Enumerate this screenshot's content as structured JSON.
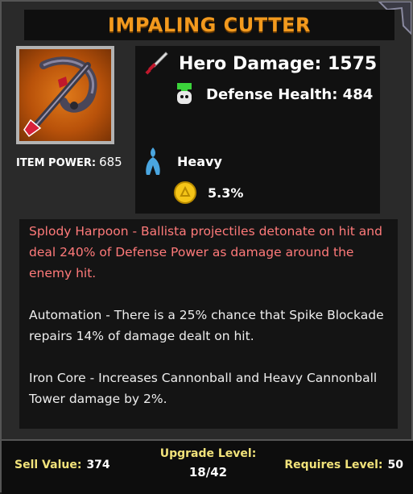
{
  "title": "IMPALING CUTTER",
  "item": {
    "power_label": "ITEM POWER:",
    "power_value": "685",
    "icon": "harpoon-ballista-icon"
  },
  "stats": {
    "hero_damage": "Hero Damage: 1575",
    "defense_health": "Defense Health: 484",
    "type": "Heavy",
    "percent": "5.3%"
  },
  "description": {
    "p1": "Splody Harpoon - Ballista projectiles detonate on hit and deal 240% of Defense Power as damage around the enemy hit.",
    "p2": "Automation - There is a 25% chance that Spike Blockade repairs 14% of damage dealt on hit.",
    "p3": "Iron Core - Increases Cannonball and Heavy Cannonball Tower damage by 2%."
  },
  "footer": {
    "sell_label": "Sell Value:",
    "sell_value": "374",
    "upgrade_label": "Upgrade Level:",
    "upgrade_value": "18/42",
    "requires_label": "Requires Level:",
    "requires_value": "50"
  },
  "colors": {
    "title": "#f39a1e",
    "description_highlight": "#ff7a7a",
    "footer_label": "#f1e27a"
  }
}
